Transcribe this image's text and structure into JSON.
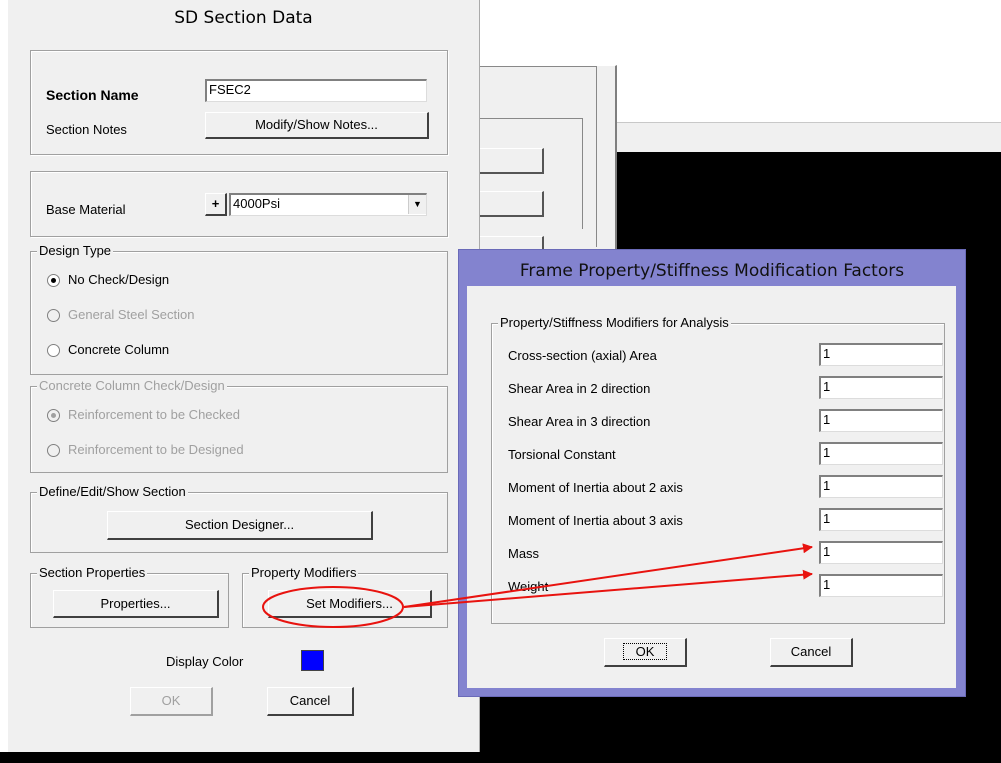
{
  "section_dialog": {
    "title": "SD Section Data",
    "section_name_label": "Section Name",
    "section_name_value": "FSEC2",
    "section_notes_label": "Section Notes",
    "modify_notes_button": "Modify/Show Notes...",
    "base_material_label": "Base Material",
    "plus_button": "+",
    "base_material_value": "4000Psi",
    "design_type": {
      "label": "Design Type",
      "options": [
        "No Check/Design",
        "General Steel Section",
        "Concrete Column"
      ],
      "selected": "No Check/Design"
    },
    "concrete_check": {
      "label": "Concrete Column Check/Design",
      "options": [
        "Reinforcement to be Checked",
        "Reinforcement to be Designed"
      ],
      "selected": "Reinforcement to be Checked"
    },
    "define_group_label": "Define/Edit/Show Section",
    "section_designer_button": "Section Designer...",
    "section_properties_label": "Section Properties",
    "properties_button": "Properties...",
    "property_modifiers_label": "Property Modifiers",
    "set_modifiers_button": "Set Modifiers...",
    "display_color_label": "Display Color",
    "display_color": "#0000ff",
    "ok_button": "OK",
    "cancel_button": "Cancel"
  },
  "modifiers_dialog": {
    "title": "Frame Property/Stiffness Modification Factors",
    "group_label": "Property/Stiffness Modifiers for Analysis",
    "rows": [
      {
        "label": "Cross-section (axial) Area",
        "value": "1"
      },
      {
        "label": "Shear Area in 2 direction",
        "value": "1"
      },
      {
        "label": "Shear Area in 3 direction",
        "value": "1"
      },
      {
        "label": "Torsional Constant",
        "value": "1"
      },
      {
        "label": "Moment of Inertia about 2 axis",
        "value": "1"
      },
      {
        "label": "Moment of Inertia about 3 axis",
        "value": "1"
      },
      {
        "label": "Mass",
        "value": "1"
      },
      {
        "label": "Weight",
        "value": "1"
      }
    ],
    "ok_button": "OK",
    "cancel_button": "Cancel"
  },
  "annotation_color": "#e8130f"
}
